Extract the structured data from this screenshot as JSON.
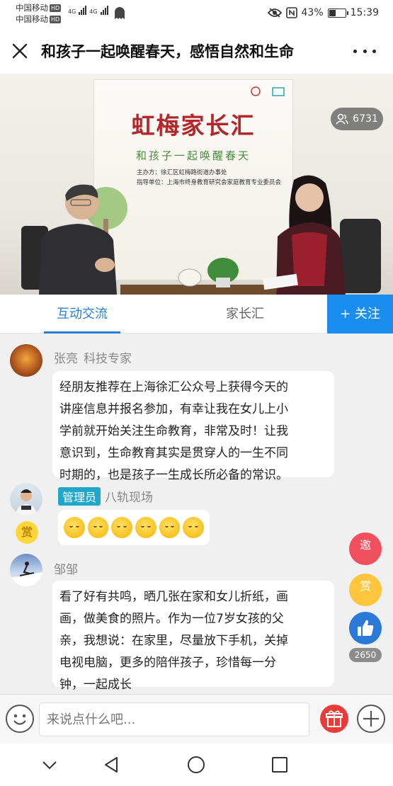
{
  "status_bar": {
    "carrier1": "中国移动",
    "carrier2": "中国移动",
    "hd": "HD",
    "net1": "4G",
    "net2": "4G",
    "battery_percent": "43%",
    "battery_level": 0.43,
    "time": "15:39"
  },
  "header": {
    "title": "和孩子一起唤醒春天，感悟自然和生命"
  },
  "video": {
    "backdrop_title": "虹梅家长汇",
    "backdrop_subtitle": "和孩子一起唤醒春天",
    "backdrop_line1": "主办方：徐汇区虹梅路街道办事处",
    "backdrop_line2": "指导单位：上海市终身教育研究会家庭教育专业委员会",
    "viewer_count": "6731"
  },
  "tabs": {
    "items": [
      {
        "label": "互动交流",
        "active": true
      },
      {
        "label": "家长汇",
        "active": false
      }
    ],
    "follow_label": "+ 关注"
  },
  "comments": [
    {
      "name": "张亮",
      "role": "科技专家",
      "lines": [
        "经朋友推荐在上海徐汇公众号上获得今天的",
        "讲座信息并报名参加，有幸让我在女儿上小",
        "学前就开始关注生命教育，非常及时！让我",
        "意识到，生命教育其实是贯穿人的一生不同",
        "时期的，也是孩子一生成长所必备的常识。"
      ]
    },
    {
      "badge": "管理员",
      "name": "八轨现场",
      "reward_label": "赏",
      "emoji_count": 6
    },
    {
      "name": "邹邹",
      "lines": [
        "看了好有共鸣，晒几张在家和女儿折纸，画",
        "画，做美食的照片。作为一位7岁女孩的父",
        "亲，我想说：在家里，尽量放下手机，关掉",
        "电视电脑，更多的陪伴孩子，珍惜每一分",
        "钟，一起成长"
      ]
    }
  ],
  "floating": {
    "invite_label": "邀",
    "reward_label": "赏",
    "like_count": "2650"
  },
  "input": {
    "placeholder": "来说点什么吧..."
  },
  "colors": {
    "accent": "#2a7fd0",
    "follow_bg": "#1a8ef0",
    "admin_badge": "#1fa6c8",
    "invite": "#f04f5e",
    "reward": "#ffc53d",
    "like": "#2a78d8",
    "gift": "#ea3a3a"
  }
}
